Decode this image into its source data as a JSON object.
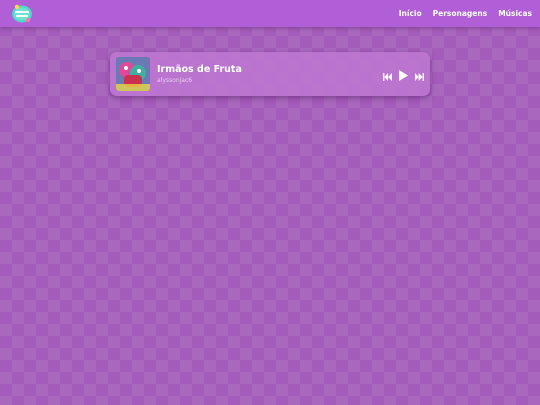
{
  "nav": {
    "links": [
      "Início",
      "Personagens",
      "Músicas"
    ]
  },
  "player": {
    "title": "Irmãos de Fruta",
    "artist": "alyssonjac6"
  },
  "icons": {
    "logo": "fruit-logo-icon",
    "prev": "skip-previous-icon",
    "play": "play-icon",
    "next": "skip-next-icon"
  },
  "colors": {
    "background": "#a35cb9",
    "navbar": "#b15fd6",
    "player_card": "#be78d2",
    "text": "#ffffff"
  }
}
